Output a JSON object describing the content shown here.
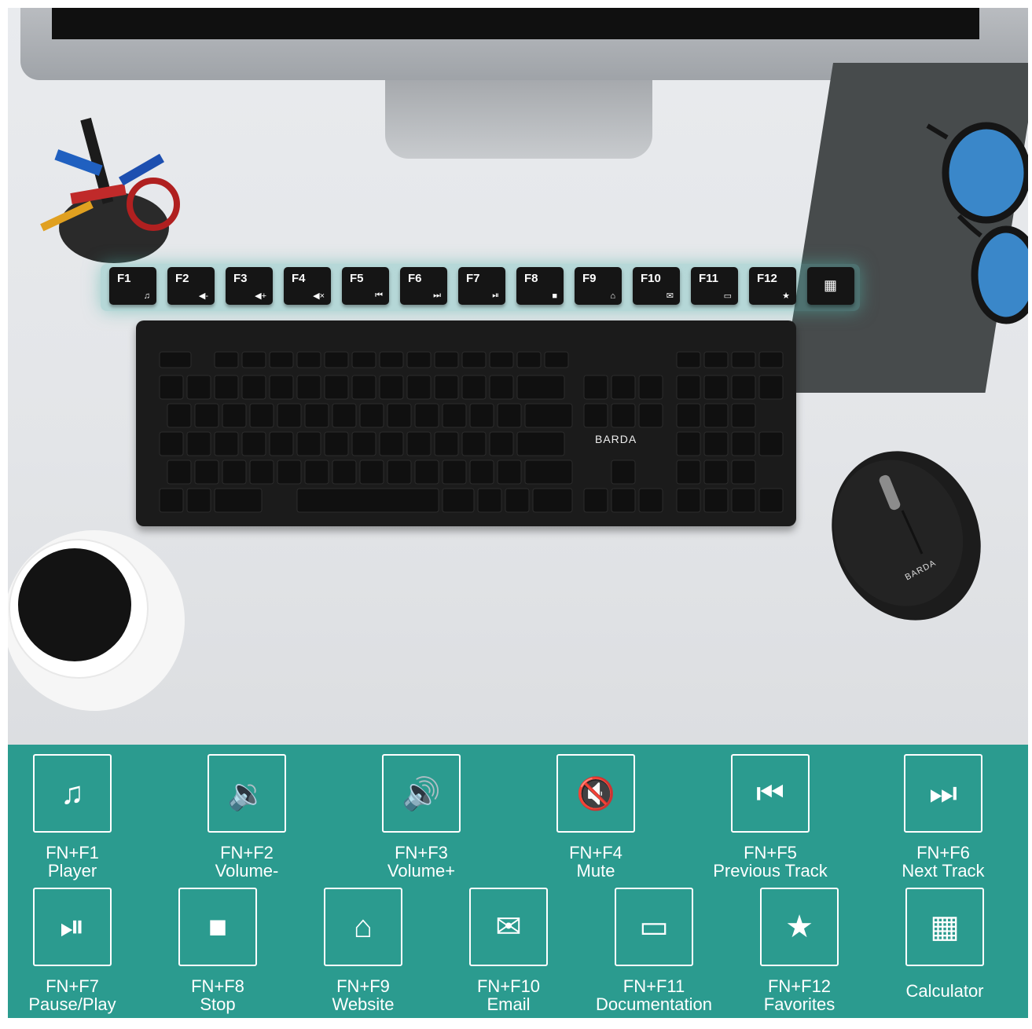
{
  "image": {
    "brand": "BARDA",
    "fn_strip": [
      {
        "label": "F1",
        "icon": "music-note-icon",
        "sym": "♫"
      },
      {
        "label": "F2",
        "icon": "volume-down-icon",
        "sym": "◀-"
      },
      {
        "label": "F3",
        "icon": "volume-up-icon",
        "sym": "◀+"
      },
      {
        "label": "F4",
        "icon": "mute-icon",
        "sym": "◀×"
      },
      {
        "label": "F5",
        "icon": "previous-track-icon",
        "sym": "⏮"
      },
      {
        "label": "F6",
        "icon": "next-track-icon",
        "sym": "⏭"
      },
      {
        "label": "F7",
        "icon": "play-pause-icon",
        "sym": "⏯"
      },
      {
        "label": "F8",
        "icon": "stop-icon",
        "sym": "■"
      },
      {
        "label": "F9",
        "icon": "home-icon",
        "sym": "⌂"
      },
      {
        "label": "F10",
        "icon": "mail-icon",
        "sym": "✉"
      },
      {
        "label": "F11",
        "icon": "document-icon",
        "sym": "▭"
      },
      {
        "label": "F12",
        "icon": "star-icon",
        "sym": "★"
      },
      {
        "label": "",
        "icon": "calculator-icon",
        "sym": "▦"
      }
    ],
    "legend": [
      {
        "key": "FN+F1",
        "action": "Player",
        "icon": "music-note-icon",
        "sym": "♫"
      },
      {
        "key": "FN+F2",
        "action": "Volume-",
        "icon": "volume-down-icon",
        "sym": "🔉"
      },
      {
        "key": "FN+F3",
        "action": "Volume+",
        "icon": "volume-up-icon",
        "sym": "🔊"
      },
      {
        "key": "FN+F4",
        "action": "Mute",
        "icon": "mute-icon",
        "sym": "🔇"
      },
      {
        "key": "FN+F5",
        "action": "Previous Track",
        "icon": "previous-track-icon",
        "sym": "⏮"
      },
      {
        "key": "FN+F6",
        "action": "Next Track",
        "icon": "next-track-icon",
        "sym": "⏭"
      },
      {
        "key": "FN+F7",
        "action": "Pause/Play",
        "icon": "play-pause-icon",
        "sym": "⏯"
      },
      {
        "key": "FN+F8",
        "action": "Stop",
        "icon": "stop-icon",
        "sym": "■"
      },
      {
        "key": "FN+F9",
        "action": "Website",
        "icon": "home-icon",
        "sym": "⌂"
      },
      {
        "key": "FN+F10",
        "action": "Email",
        "icon": "mail-icon",
        "sym": "✉"
      },
      {
        "key": "FN+F11",
        "action": "Documentation",
        "icon": "document-icon",
        "sym": "▭"
      },
      {
        "key": "FN+F12",
        "action": "Favorites",
        "icon": "star-icon",
        "sym": "★"
      },
      {
        "key": "",
        "action": "Calculator",
        "icon": "calculator-icon",
        "sym": "▦"
      }
    ],
    "colors": {
      "legend_bg": "#2b9b8f",
      "keyboard": "#1b1b1b",
      "desk": "#e5e7ea"
    }
  }
}
